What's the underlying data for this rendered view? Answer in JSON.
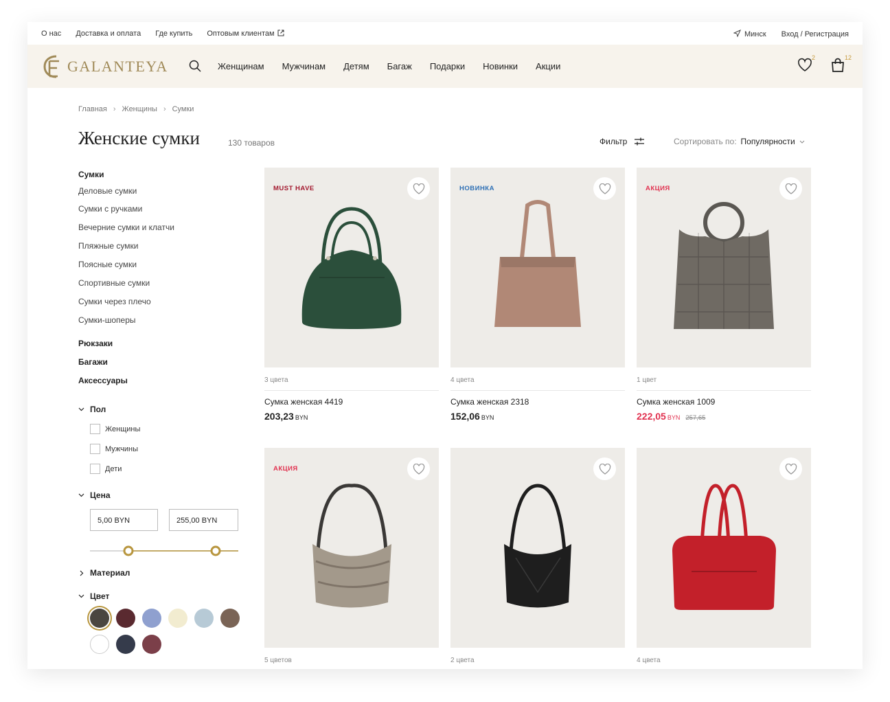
{
  "topbar": {
    "links": [
      "О нас",
      "Доставка и оплата",
      "Где купить",
      "Оптовым клиентам"
    ],
    "city": "Минск",
    "auth": "Вход / Регистрация"
  },
  "header": {
    "logo_text": "GALANTEYA",
    "nav": [
      "Женщинам",
      "Мужчинам",
      "Детям",
      "Багаж",
      "Подарки",
      "Новинки",
      "Акции"
    ],
    "wishlist_count": "2",
    "cart_count": "12"
  },
  "breadcrumbs": [
    "Главная",
    "Женщины",
    "Сумки"
  ],
  "page": {
    "title": "Женские сумки",
    "count": "130 товаров",
    "filter_label": "Фильтр",
    "sort_label": "Сортировать по:",
    "sort_value": "Популярности"
  },
  "sidebar": {
    "category_title": "Сумки",
    "subcategories": [
      "Деловые сумки",
      "Сумки с ручками",
      "Вечерние сумки и клатчи",
      "Пляжные сумки",
      "Поясные сумки",
      "Спортивные сумки",
      "Сумки через плечо",
      "Сумки-шоперы"
    ],
    "other_categories": [
      "Рюкзаки",
      "Багажи",
      "Аксессуары"
    ],
    "gender": {
      "title": "Пол",
      "options": [
        "Женщины",
        "Мужчины",
        "Дети"
      ]
    },
    "price": {
      "title": "Цена",
      "min": "5,00 BYN",
      "max": "255,00 BYN"
    },
    "material": {
      "title": "Материал"
    },
    "color": {
      "title": "Цвет",
      "swatches": [
        "#4a4640",
        "#5a2a30",
        "#8fa0cf",
        "#f2ecd0",
        "#b7cad6",
        "#7a6456",
        "#ffffff",
        "#353b4b",
        "#7b3f49"
      ]
    }
  },
  "products": [
    {
      "label": "MUST HAVE",
      "label_color": "#a3182e",
      "colors": "3 цвета",
      "name": "Сумка женская 4419",
      "price": "203,23",
      "currency": "BYN",
      "old_price": "",
      "bag_color": "#2b4f3b"
    },
    {
      "label": "НОВИНКА",
      "label_color": "#2d6fb5",
      "colors": "4 цвета",
      "name": "Сумка женская 2318",
      "price": "152,06",
      "currency": "BYN",
      "old_price": "",
      "bag_color": "#b18876"
    },
    {
      "label": "АКЦИЯ",
      "label_color": "#e1314f",
      "colors": "1 цвет",
      "name": "Сумка женская 1009",
      "price": "222,05",
      "currency": "BYN",
      "old_price": "257,65",
      "bag_color": "#6f6a63"
    },
    {
      "label": "АКЦИЯ",
      "label_color": "#e1314f",
      "colors": "5 цветов",
      "name": "",
      "price": "",
      "currency": "",
      "old_price": "",
      "bag_color": "#a3998b"
    },
    {
      "label": "",
      "label_color": "",
      "colors": "2 цвета",
      "name": "",
      "price": "",
      "currency": "",
      "old_price": "",
      "bag_color": "#1e1e1e"
    },
    {
      "label": "",
      "label_color": "",
      "colors": "4 цвета",
      "name": "",
      "price": "",
      "currency": "",
      "old_price": "",
      "bag_color": "#c3202a"
    }
  ]
}
